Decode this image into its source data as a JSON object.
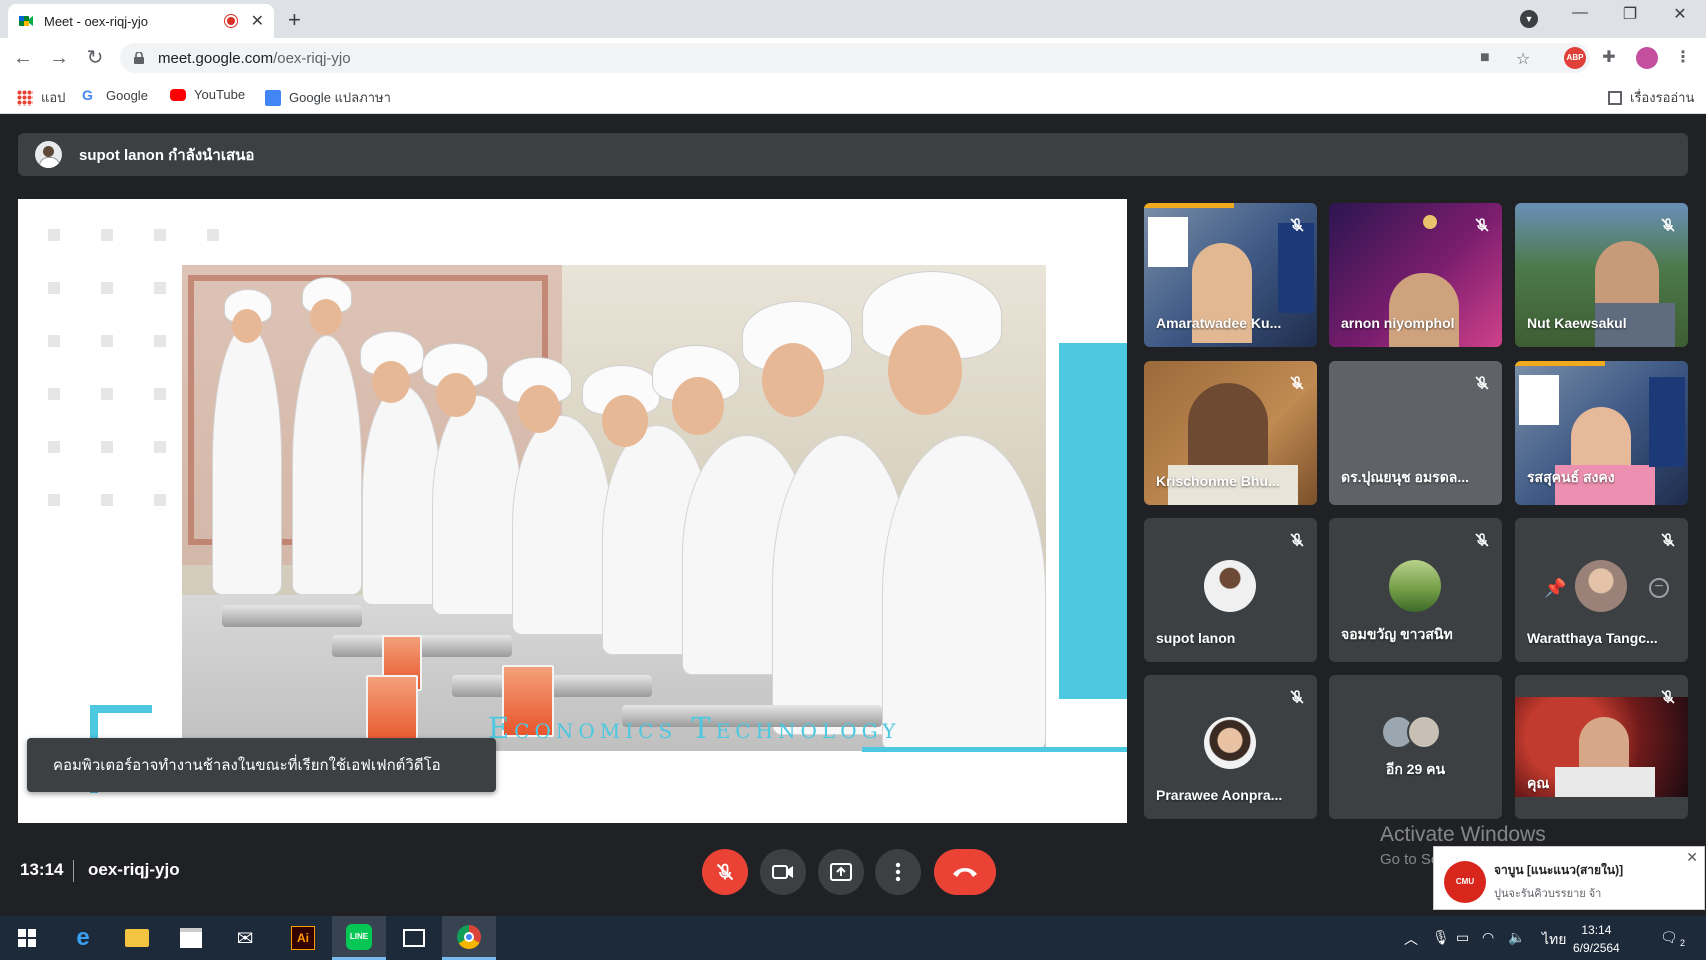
{
  "browser": {
    "tab_title": "Meet - oex-riqj-yjo",
    "url_host": "meet.google.com",
    "url_path": "/oex-riqj-yjo",
    "bookmarks": [
      {
        "label": "แอป"
      },
      {
        "label": "Google"
      },
      {
        "label": "YouTube"
      },
      {
        "label": "Google แปลภาษา"
      }
    ],
    "reading_list": "เรื่องรออ่าน",
    "ext_abp": "ABP"
  },
  "meet": {
    "presenter_text": "supot lanon กำลังนำเสนอ",
    "slide_text": "Economics Technology",
    "toast": "คอมพิวเตอร์อาจทำงานช้าลงในขณะที่เรียกใช้เอฟเฟกต์วิดีโอ",
    "participants": [
      {
        "name": "Amaratwadee Ku..."
      },
      {
        "name": "arnon niyomphol"
      },
      {
        "name": "Nut Kaewsakul"
      },
      {
        "name": "Krischonme Bhu..."
      },
      {
        "name": "ดร.ปุณยนุช อมรดล..."
      },
      {
        "name": "รสสุคนธ์ สงคง"
      },
      {
        "name": "supot lanon"
      },
      {
        "name": "จอมขวัญ ขาวสนิท"
      },
      {
        "name": "Waratthaya Tangc..."
      },
      {
        "name": "Prarawee Aonpra..."
      },
      {
        "name": "อีก 29 คน"
      },
      {
        "name": "คุณ"
      }
    ],
    "time": "13:14",
    "meeting_code": "oex-riqj-yjo"
  },
  "windows": {
    "activate_title": "Activate Windows",
    "activate_sub": "Go to Settings to activate Windows.",
    "notification_title": "จาบูน [แนะแนว(สายใน)]",
    "notification_body": "ปูนจะรันคิวบรรยาย จ้า",
    "notification_logo": "CMU",
    "clock_time": "13:14",
    "clock_date": "6/9/2564",
    "language": "ไทย",
    "notif_count": "2"
  },
  "colors": {
    "meet_bg": "#202124",
    "tile_bg": "#3c4043",
    "accent_red": "#ea4335",
    "slide_cyan": "#4cc8e0"
  }
}
